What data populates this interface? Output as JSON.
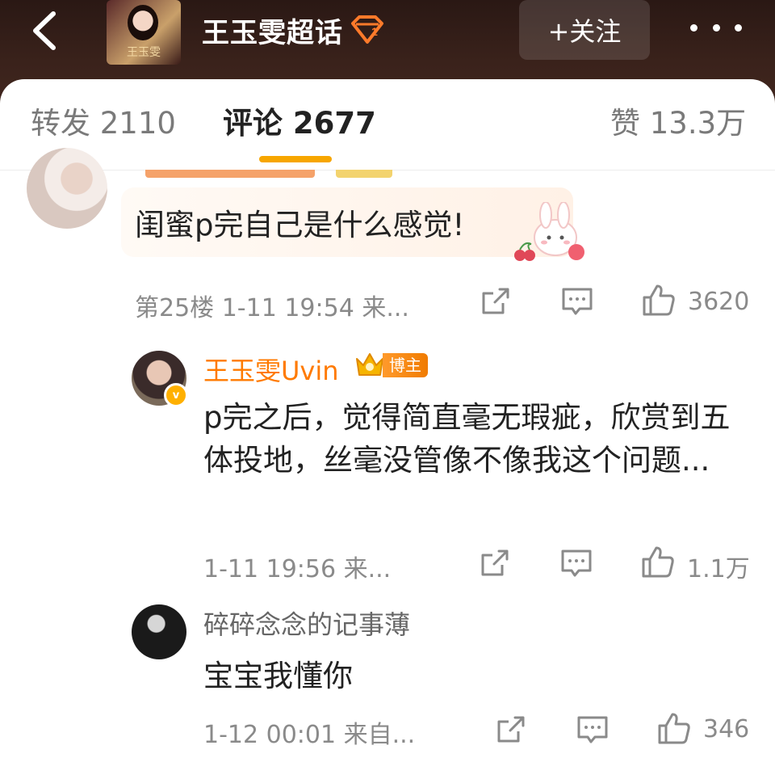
{
  "header": {
    "title": "王玉雯超话",
    "follow_label": "+关注",
    "cover_text": "王玉雯"
  },
  "tabs": [
    {
      "label": "转发 2110"
    },
    {
      "label": "评论 2677"
    },
    {
      "label": "赞 13.3万"
    }
  ],
  "comments": [
    {
      "text": "闺蜜p完自己是什么感觉!",
      "meta": "第25楼 1-11 19:54 来...",
      "likes": "3620"
    },
    {
      "name": "王玉雯Uvin",
      "badge": "博主",
      "text": "p完之后，觉得简直毫无瑕疵，欣赏到五体投地，丝毫没管像不像我这个问题...",
      "meta": "1-11 19:56 来...",
      "likes": "1.1万"
    },
    {
      "name": "碎碎念念的记事薄",
      "text": "宝宝我懂你",
      "meta": "1-12 00:01 来自...",
      "likes": "346"
    }
  ],
  "colors": {
    "accent": "#f7a600",
    "blogger_name": "#ff7a00",
    "header_bg": "#3a221b"
  }
}
